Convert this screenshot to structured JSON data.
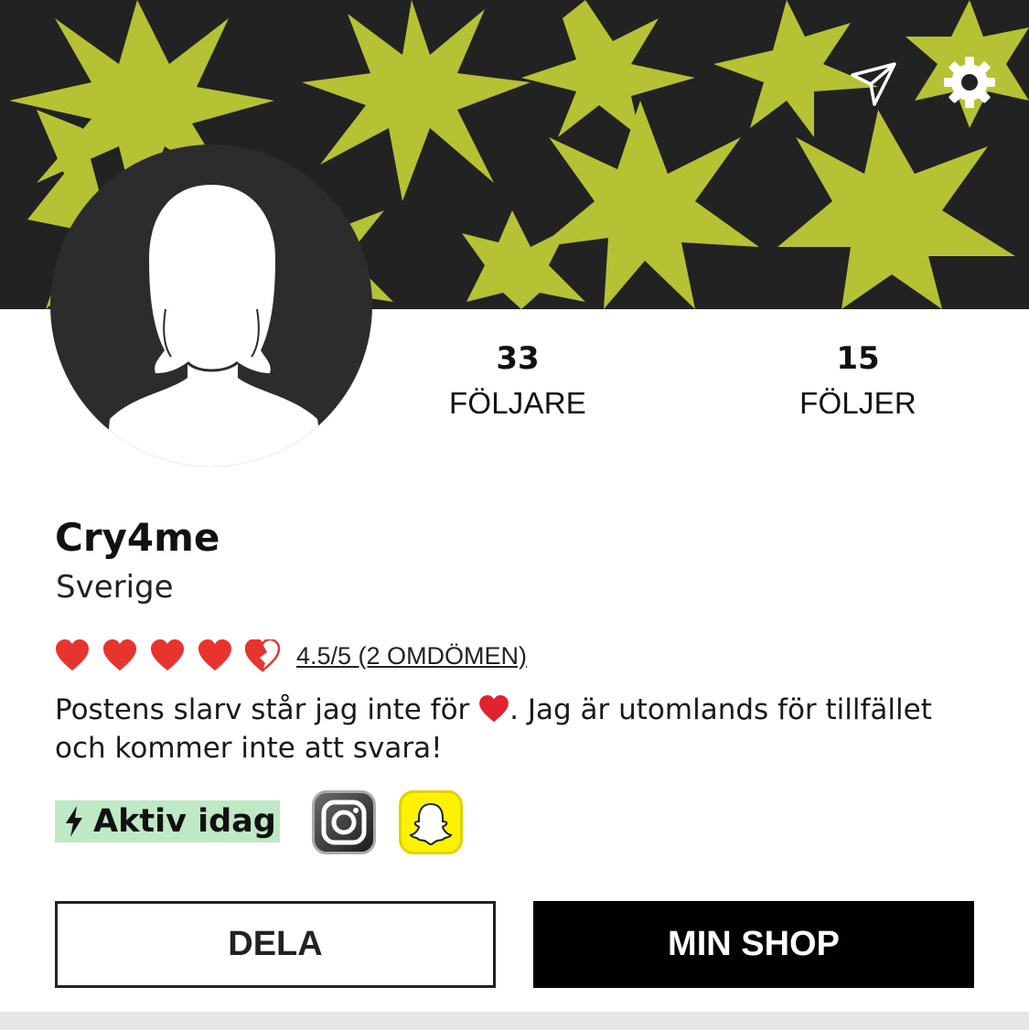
{
  "header": {
    "background_color": "#222222",
    "star_color": "#b5c234",
    "send_icon": "send-icon",
    "settings_icon": "gear-icon"
  },
  "profile": {
    "avatar_icon": "person-silhouette-icon",
    "followers": {
      "count": "33",
      "label": "FÖLJARE"
    },
    "following": {
      "count": "15",
      "label": "FÖLJER"
    },
    "username": "Cry4me",
    "country": "Sverige",
    "rating": {
      "value": 4.5,
      "max": 5,
      "heart_color": "#e8342f",
      "text": "4.5/5 (2 OMDÖMEN)"
    },
    "bio": {
      "part1": "Postens slarv står jag inte för ",
      "part2": ". Jag är utomlands för tillfället och kommer inte att svara!"
    },
    "status": {
      "label": "Aktiv idag",
      "color": "#bfe8c5"
    },
    "social": [
      "instagram-icon",
      "snapchat-icon"
    ]
  },
  "actions": {
    "share_label": "DELA",
    "shop_label": "MIN SHOP"
  }
}
